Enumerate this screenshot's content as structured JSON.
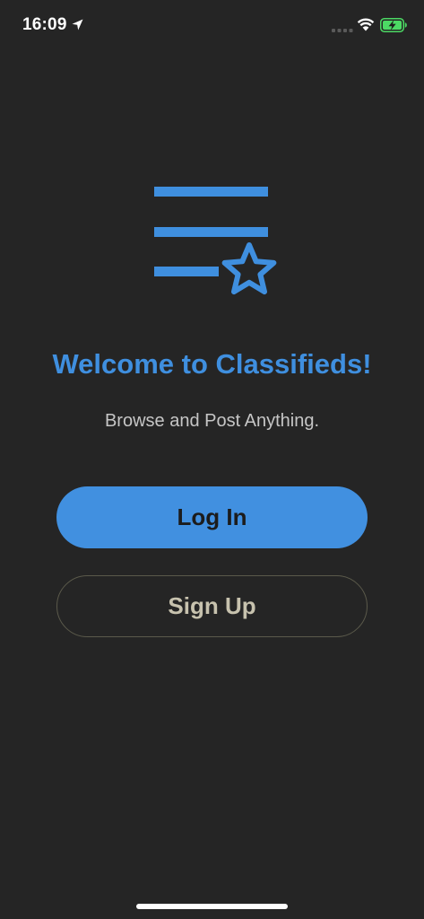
{
  "status_bar": {
    "time": "16:09",
    "icons": [
      "location-arrow-icon",
      "cellular-signal-icon",
      "wifi-icon",
      "battery-charging-icon"
    ]
  },
  "welcome": {
    "logo_icon": "list-star-icon",
    "title": "Welcome to Classifieds!",
    "subtitle": "Browse and Post Anything."
  },
  "actions": {
    "login_label": "Log In",
    "signup_label": "Sign Up"
  },
  "colors": {
    "background": "#252525",
    "accent": "#4190e0",
    "title": "#3f8fdf",
    "signup_text": "#c7c2ae",
    "battery_green": "#4cd964"
  }
}
